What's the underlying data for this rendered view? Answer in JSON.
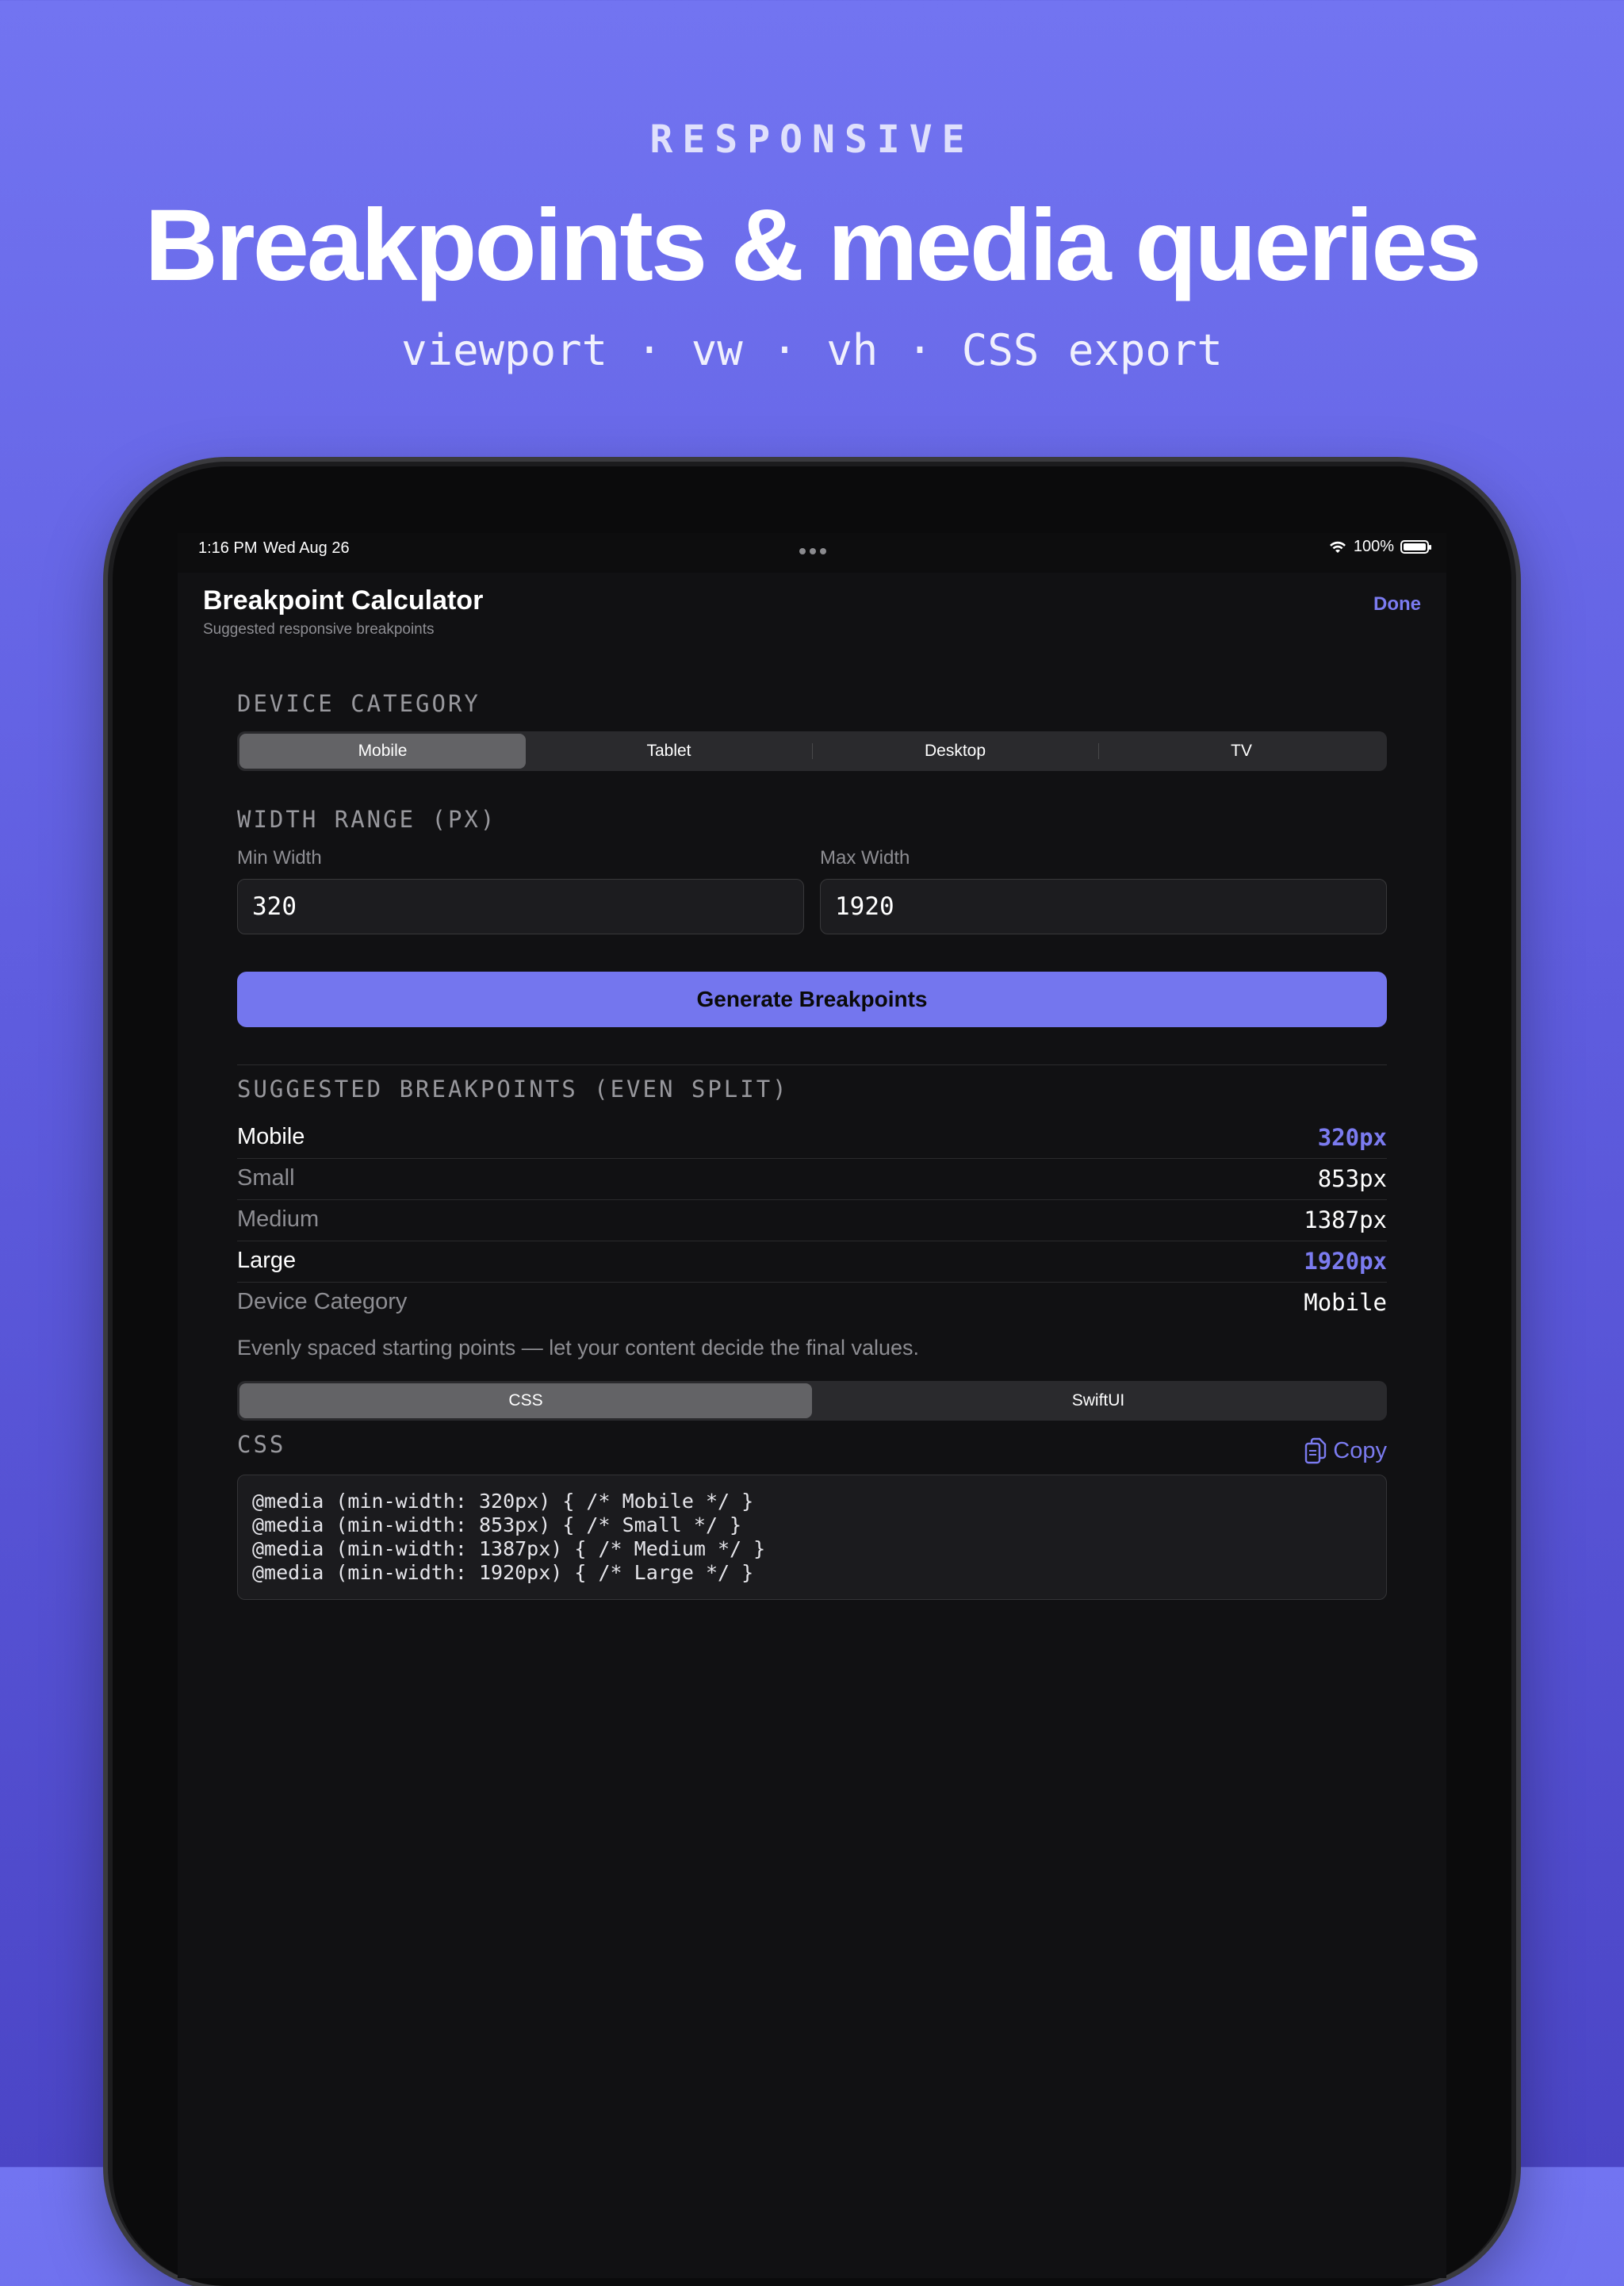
{
  "hero": {
    "eyebrow": "RESPONSIVE",
    "headline": "Breakpoints & media queries",
    "subline": "viewport · vw · vh · CSS export"
  },
  "statusbar": {
    "time": "1:16 PM",
    "date": "Wed Aug 26",
    "battery": "100%",
    "icons": [
      "wifi-icon",
      "battery-icon",
      "multitasking-dots-icon"
    ]
  },
  "nav": {
    "title": "Breakpoint Calculator",
    "subtitle": "Suggested responsive breakpoints",
    "done": "Done"
  },
  "device_category": {
    "label": "DEVICE CATEGORY",
    "options": [
      "Mobile",
      "Tablet",
      "Desktop",
      "TV"
    ],
    "selected": "Mobile"
  },
  "width_range": {
    "label": "WIDTH RANGE (PX)",
    "min_label": "Min Width",
    "min_value": "320",
    "max_label": "Max Width",
    "max_value": "1920"
  },
  "generate_button": "Generate Breakpoints",
  "suggested": {
    "label": "SUGGESTED BREAKPOINTS (EVEN SPLIT)",
    "rows": [
      {
        "name": "Mobile",
        "value": "320px"
      },
      {
        "name": "Small",
        "value": "853px"
      },
      {
        "name": "Medium",
        "value": "1387px"
      },
      {
        "name": "Large",
        "value": "1920px"
      },
      {
        "name": "Device Category",
        "value": "Mobile"
      }
    ],
    "note": "Evenly spaced starting points — let your content decide the final values."
  },
  "export": {
    "options": [
      "CSS",
      "SwiftUI"
    ],
    "selected": "CSS",
    "label": "CSS",
    "copy": "Copy",
    "code_lines": [
      "@media (min-width: 320px) { /* Mobile */ }",
      "@media (min-width: 853px) { /* Small */ }",
      "@media (min-width: 1387px) { /* Medium */ }",
      "@media (min-width: 1920px) { /* Large */ }"
    ]
  },
  "colors": {
    "accent": "#7B7BF0",
    "button": "#7476EE",
    "background_top": "#7274F1",
    "background_bottom": "#4B45C6",
    "screen": "#111113"
  }
}
